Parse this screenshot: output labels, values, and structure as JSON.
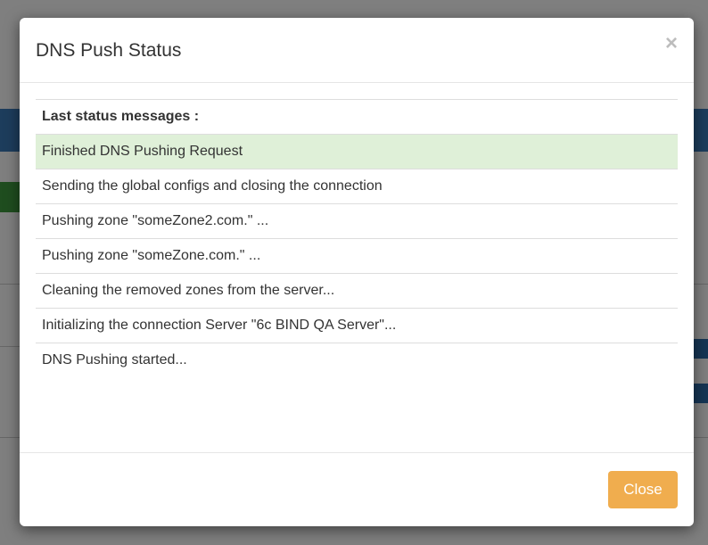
{
  "modal": {
    "title": "DNS Push Status",
    "close_symbol": "×",
    "table_header": "Last status messages :",
    "messages": [
      "Finished DNS Pushing Request",
      "Sending the global configs and closing the connection",
      "Pushing zone \"someZone2.com.\" ...",
      "Pushing zone \"someZone.com.\" ...",
      "Cleaning the removed zones from the server...",
      "Initializing the connection Server \"6c BIND QA Server\"...",
      "DNS Pushing started..."
    ],
    "close_button_label": "Close"
  },
  "colors": {
    "success_row": "#dff0d8",
    "close_button": "#f0ad4e"
  },
  "icons": {
    "close": "close-icon"
  }
}
